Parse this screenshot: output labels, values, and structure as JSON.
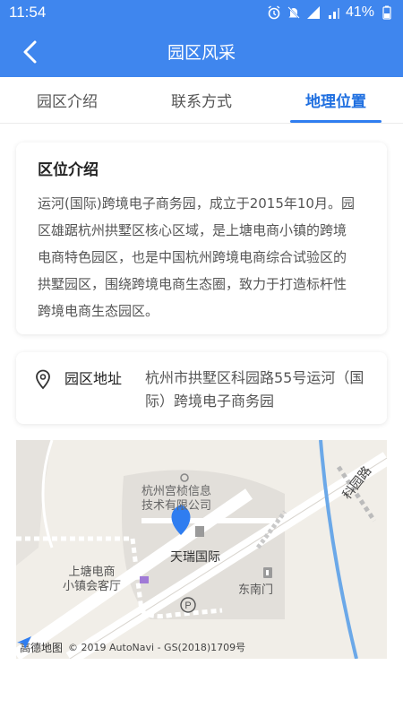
{
  "status": {
    "time": "11:54",
    "battery": "41%"
  },
  "nav": {
    "title": "园区风采",
    "back_label": ""
  },
  "tabs": [
    {
      "label": "园区介绍",
      "active": false
    },
    {
      "label": "联系方式",
      "active": false
    },
    {
      "label": "地理位置",
      "active": true
    }
  ],
  "intro": {
    "title": "区位介绍",
    "lines": [
      "运河(国际)跨境电子商务园，成立于2015年10月。园",
      "区雄踞杭州拱墅区核心区域，是上塘电商小镇的跨境",
      "电商特色园区，也是中国杭州跨境电商综合试验区的",
      "拱墅园区，围绕跨境电商生态圈，致力于打造标杆性",
      "跨境电商生态园区。"
    ]
  },
  "address": {
    "label": "园区地址",
    "lines": [
      "杭州市拱墅区科园路55号运河（国",
      "际）跨境电子商务园"
    ]
  },
  "map": {
    "poi_company": [
      "杭州宫桢信息",
      "技术有限公司"
    ],
    "poi_main": "天瑞国际",
    "poi_town": [
      "上塘电商",
      "小镇会客厅"
    ],
    "poi_gate": "东南门",
    "road_name": "科园路",
    "parking": "P",
    "logo_text": "高德地图",
    "copyright": "© 2019 AutoNavi - GS(2018)1709号"
  },
  "colors": {
    "header": "#3f86ee",
    "accent": "#1f6fe0",
    "pin": "#2f7df0"
  }
}
